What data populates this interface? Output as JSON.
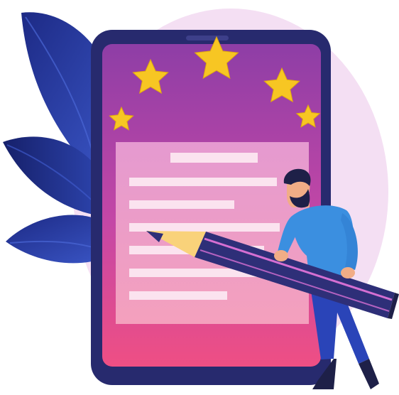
{
  "illustration": {
    "subject": "rating-review-form",
    "stars_shown": 5,
    "icons": [
      "star-icon",
      "pencil-icon",
      "tablet-icon",
      "leaf-icon",
      "person-figure"
    ],
    "colors": {
      "background_blob": "#f3dcf3",
      "tablet_frame": "#272a6e",
      "screen_top": "#8e3ea6",
      "screen_bottom": "#ef4f84",
      "form_panel": "#f4a9cd",
      "form_lines": "#fbe3ef",
      "star": "#f7c623",
      "leaf_dark": "#1f2a7a",
      "leaf_light": "#3a55c4",
      "pencil_body": "#2e2f78",
      "pencil_stripe": "#d56fd2",
      "pencil_wood": "#f9d27a",
      "shirt": "#3b8fe0",
      "pants": "#2a44b8",
      "hair": "#1e2048",
      "skin": "#f1ad86"
    }
  }
}
